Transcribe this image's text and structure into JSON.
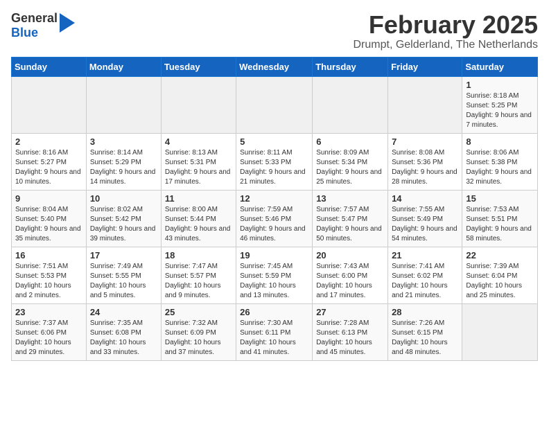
{
  "header": {
    "logo_general": "General",
    "logo_blue": "Blue",
    "title": "February 2025",
    "location": "Drumpt, Gelderland, The Netherlands"
  },
  "weekdays": [
    "Sunday",
    "Monday",
    "Tuesday",
    "Wednesday",
    "Thursday",
    "Friday",
    "Saturday"
  ],
  "weeks": [
    [
      {
        "day": "",
        "info": ""
      },
      {
        "day": "",
        "info": ""
      },
      {
        "day": "",
        "info": ""
      },
      {
        "day": "",
        "info": ""
      },
      {
        "day": "",
        "info": ""
      },
      {
        "day": "",
        "info": ""
      },
      {
        "day": "1",
        "info": "Sunrise: 8:18 AM\nSunset: 5:25 PM\nDaylight: 9 hours and 7 minutes."
      }
    ],
    [
      {
        "day": "2",
        "info": "Sunrise: 8:16 AM\nSunset: 5:27 PM\nDaylight: 9 hours and 10 minutes."
      },
      {
        "day": "3",
        "info": "Sunrise: 8:14 AM\nSunset: 5:29 PM\nDaylight: 9 hours and 14 minutes."
      },
      {
        "day": "4",
        "info": "Sunrise: 8:13 AM\nSunset: 5:31 PM\nDaylight: 9 hours and 17 minutes."
      },
      {
        "day": "5",
        "info": "Sunrise: 8:11 AM\nSunset: 5:33 PM\nDaylight: 9 hours and 21 minutes."
      },
      {
        "day": "6",
        "info": "Sunrise: 8:09 AM\nSunset: 5:34 PM\nDaylight: 9 hours and 25 minutes."
      },
      {
        "day": "7",
        "info": "Sunrise: 8:08 AM\nSunset: 5:36 PM\nDaylight: 9 hours and 28 minutes."
      },
      {
        "day": "8",
        "info": "Sunrise: 8:06 AM\nSunset: 5:38 PM\nDaylight: 9 hours and 32 minutes."
      }
    ],
    [
      {
        "day": "9",
        "info": "Sunrise: 8:04 AM\nSunset: 5:40 PM\nDaylight: 9 hours and 35 minutes."
      },
      {
        "day": "10",
        "info": "Sunrise: 8:02 AM\nSunset: 5:42 PM\nDaylight: 9 hours and 39 minutes."
      },
      {
        "day": "11",
        "info": "Sunrise: 8:00 AM\nSunset: 5:44 PM\nDaylight: 9 hours and 43 minutes."
      },
      {
        "day": "12",
        "info": "Sunrise: 7:59 AM\nSunset: 5:46 PM\nDaylight: 9 hours and 46 minutes."
      },
      {
        "day": "13",
        "info": "Sunrise: 7:57 AM\nSunset: 5:47 PM\nDaylight: 9 hours and 50 minutes."
      },
      {
        "day": "14",
        "info": "Sunrise: 7:55 AM\nSunset: 5:49 PM\nDaylight: 9 hours and 54 minutes."
      },
      {
        "day": "15",
        "info": "Sunrise: 7:53 AM\nSunset: 5:51 PM\nDaylight: 9 hours and 58 minutes."
      }
    ],
    [
      {
        "day": "16",
        "info": "Sunrise: 7:51 AM\nSunset: 5:53 PM\nDaylight: 10 hours and 2 minutes."
      },
      {
        "day": "17",
        "info": "Sunrise: 7:49 AM\nSunset: 5:55 PM\nDaylight: 10 hours and 5 minutes."
      },
      {
        "day": "18",
        "info": "Sunrise: 7:47 AM\nSunset: 5:57 PM\nDaylight: 10 hours and 9 minutes."
      },
      {
        "day": "19",
        "info": "Sunrise: 7:45 AM\nSunset: 5:59 PM\nDaylight: 10 hours and 13 minutes."
      },
      {
        "day": "20",
        "info": "Sunrise: 7:43 AM\nSunset: 6:00 PM\nDaylight: 10 hours and 17 minutes."
      },
      {
        "day": "21",
        "info": "Sunrise: 7:41 AM\nSunset: 6:02 PM\nDaylight: 10 hours and 21 minutes."
      },
      {
        "day": "22",
        "info": "Sunrise: 7:39 AM\nSunset: 6:04 PM\nDaylight: 10 hours and 25 minutes."
      }
    ],
    [
      {
        "day": "23",
        "info": "Sunrise: 7:37 AM\nSunset: 6:06 PM\nDaylight: 10 hours and 29 minutes."
      },
      {
        "day": "24",
        "info": "Sunrise: 7:35 AM\nSunset: 6:08 PM\nDaylight: 10 hours and 33 minutes."
      },
      {
        "day": "25",
        "info": "Sunrise: 7:32 AM\nSunset: 6:09 PM\nDaylight: 10 hours and 37 minutes."
      },
      {
        "day": "26",
        "info": "Sunrise: 7:30 AM\nSunset: 6:11 PM\nDaylight: 10 hours and 41 minutes."
      },
      {
        "day": "27",
        "info": "Sunrise: 7:28 AM\nSunset: 6:13 PM\nDaylight: 10 hours and 45 minutes."
      },
      {
        "day": "28",
        "info": "Sunrise: 7:26 AM\nSunset: 6:15 PM\nDaylight: 10 hours and 48 minutes."
      },
      {
        "day": "",
        "info": ""
      }
    ]
  ]
}
